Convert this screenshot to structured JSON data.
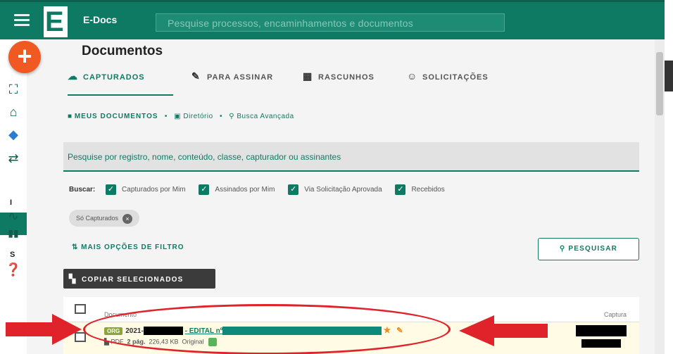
{
  "app": {
    "name": "E-Docs",
    "logo_letter": "E",
    "search_placeholder": "Pesquise processos, encaminhamentos e documentos"
  },
  "fab": {
    "label": "+"
  },
  "rail": {
    "icons": [
      "fullscreen-icon",
      "home-icon",
      "cubes-icon",
      "transfer-icon",
      "document-icon",
      "chart-line-icon",
      "bar-chart-icon",
      "help-icon"
    ],
    "letters": [
      "I",
      "S"
    ]
  },
  "page": {
    "title": "Documentos"
  },
  "tabs": [
    {
      "label": "CAPTURADOS",
      "icon": "cloud-upload-icon",
      "active": true
    },
    {
      "label": "PARA ASSINAR",
      "icon": "pen-icon",
      "active": false
    },
    {
      "label": "RASCUNHOS",
      "icon": "drafts-icon",
      "active": false
    },
    {
      "label": "SOLICITAÇÕES",
      "icon": "request-icon",
      "active": false
    }
  ],
  "breadcrumb": {
    "root": "MEUS DOCUMENTOS",
    "items": [
      "Diretório",
      "Busca Avançada"
    ],
    "separator": "•"
  },
  "doc_search": {
    "placeholder": "Pesquise por registro, nome, conteúdo, classe, capturador ou assinantes"
  },
  "buscar": {
    "label": "Buscar:",
    "options": [
      {
        "label": "Capturados por Mim",
        "checked": true
      },
      {
        "label": "Assinados por Mim",
        "checked": true
      },
      {
        "label": "Via Solicitação Aprovada",
        "checked": true
      },
      {
        "label": "Recebidos",
        "checked": true
      }
    ]
  },
  "chip": {
    "label": "Só Capturados",
    "close": "×"
  },
  "filters": {
    "more_options": "MAIS OPÇÕES DE FILTRO",
    "search_button": "PESQUISAR"
  },
  "actions": {
    "copy_selected": "COPIAR SELECIONADOS"
  },
  "table": {
    "headers": {
      "document": "Documento",
      "capture": "Captura"
    },
    "rows": [
      {
        "badge": "ORG",
        "year_prefix": "2021-",
        "title_prefix": "- EDITAL nº",
        "format": "PDF",
        "pages": "2 pág.",
        "size": "226,43 KB",
        "original_label": "Original"
      }
    ]
  },
  "colors": {
    "brand": "#0f7a63",
    "fab": "#f05a22",
    "annotation": "#e0232b",
    "highlight_row": "#fffbe5"
  }
}
